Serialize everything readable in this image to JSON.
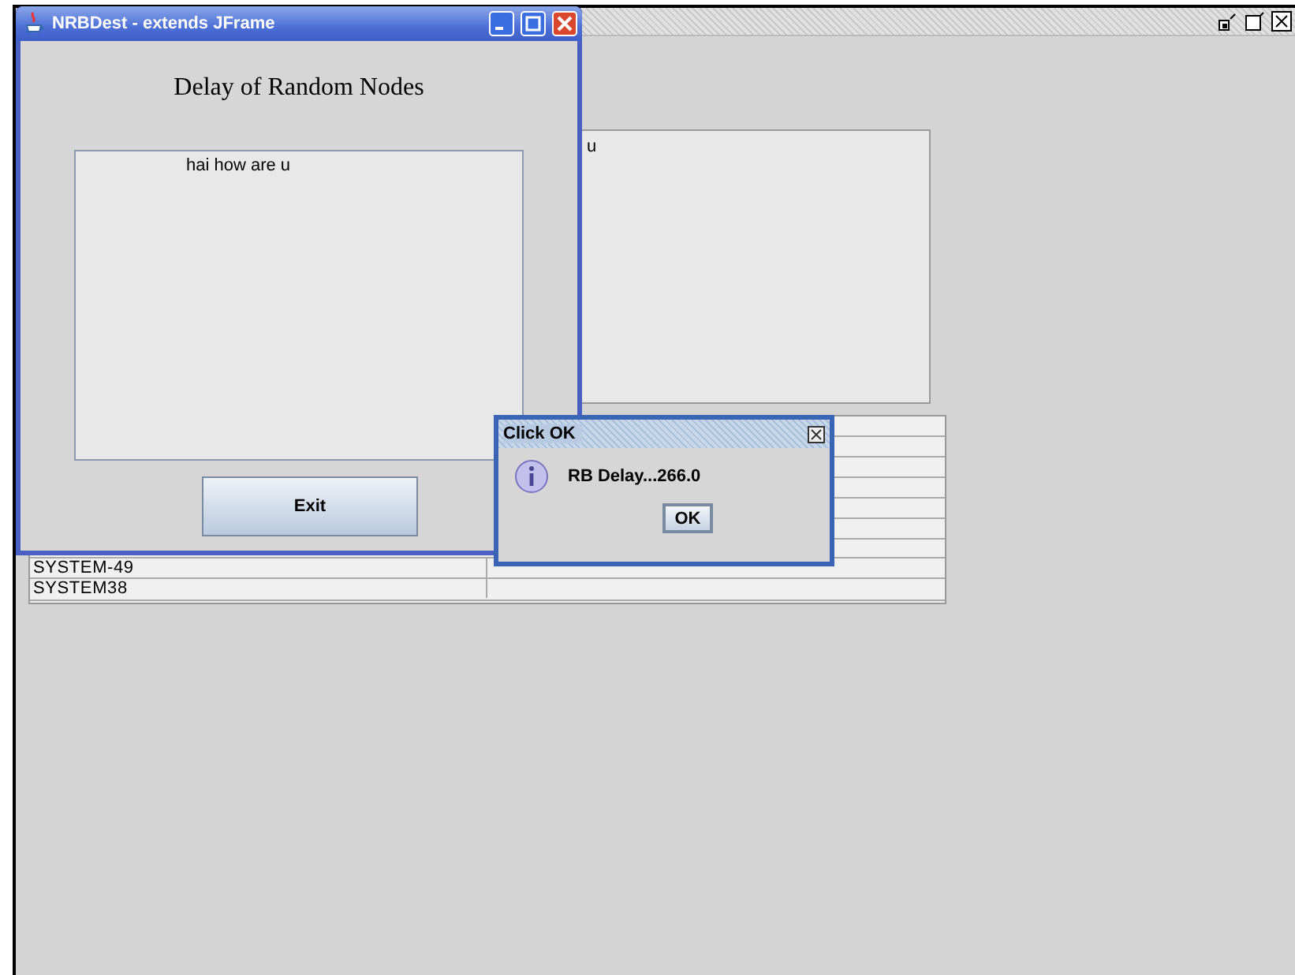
{
  "desktop_frame": {
    "buttons": [
      {
        "kind": "iconify"
      },
      {
        "kind": "maximize"
      },
      {
        "kind": "close"
      }
    ]
  },
  "back_panel": {
    "text_area": "u",
    "table": {
      "rows": [
        {
          "column_1": "SYSTEM-49"
        },
        {
          "column_1": "SYSTEM38"
        }
      ]
    }
  },
  "window": {
    "title": "NRBDest - extends JFrame",
    "heading": "Delay of Random Nodes",
    "text_area": "hai how are u",
    "button": "Exit"
  },
  "dialog": {
    "title": "Click OK",
    "message": "RB Delay...266.0",
    "button": "OK"
  }
}
